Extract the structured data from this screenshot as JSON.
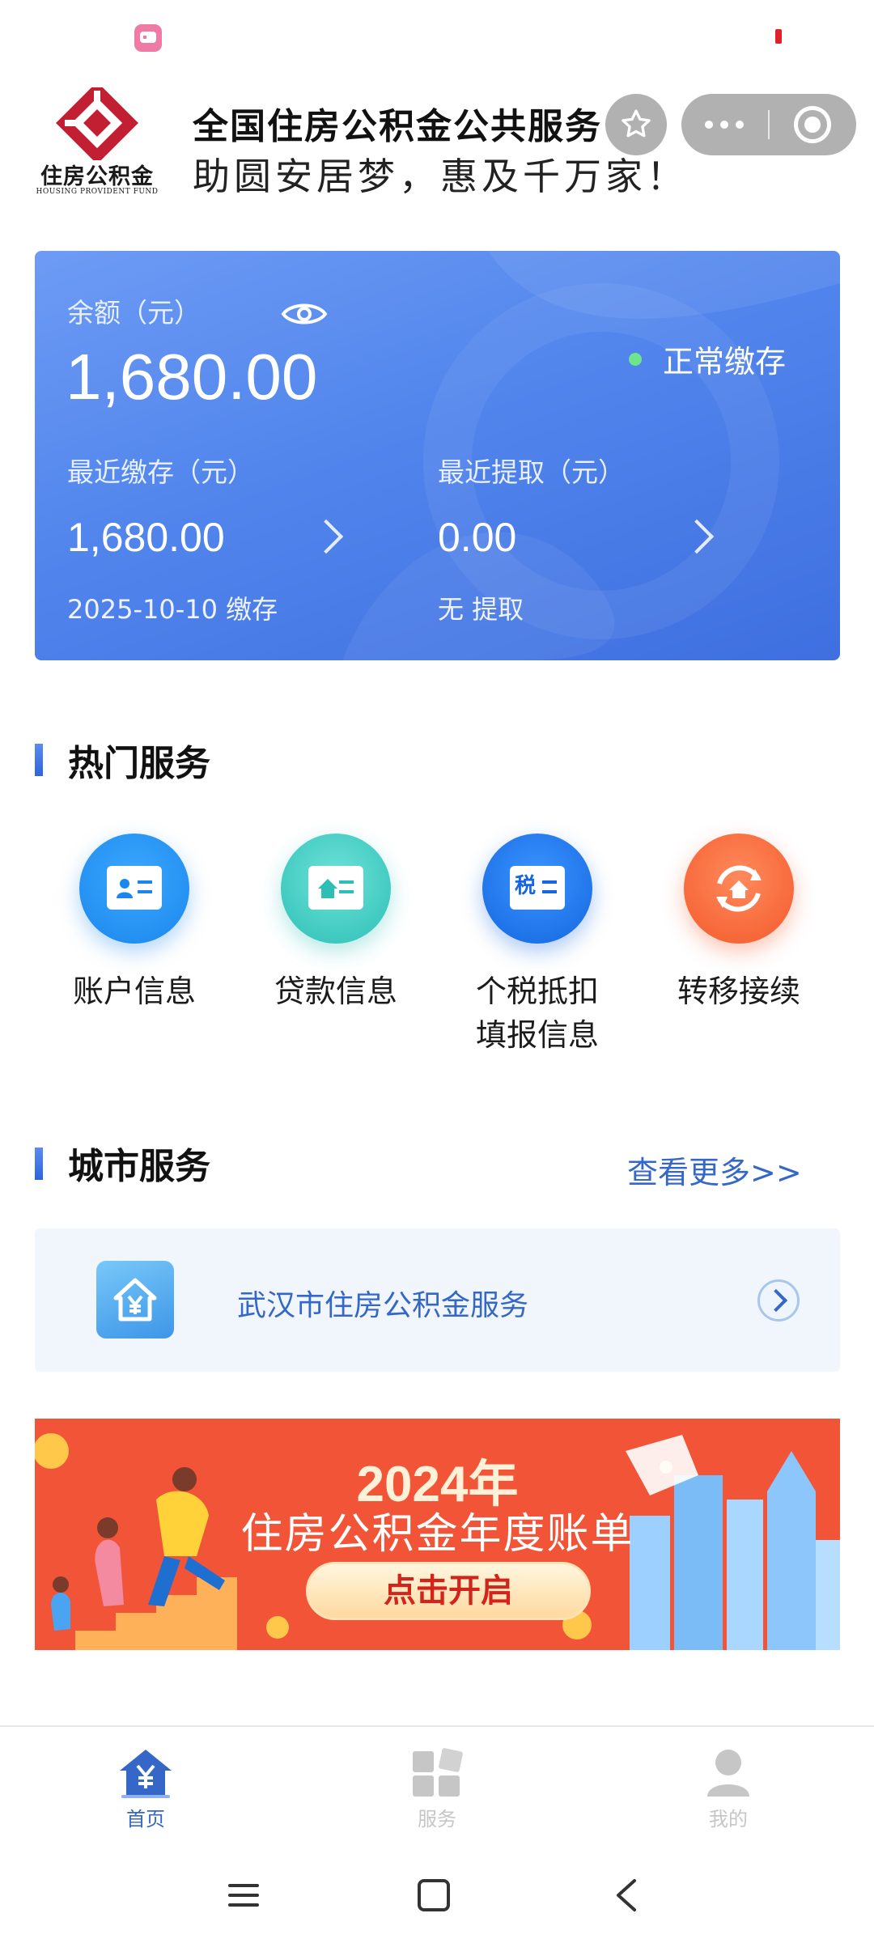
{
  "header": {
    "logo_text": "住房公积金",
    "logo_subtext": "HOUSING PROVIDENT FUND",
    "title": "全国住房公积金公共服务",
    "subtitle": "助圆安居梦，惠及千万家！"
  },
  "capsule": {
    "favorite_icon": "star-icon",
    "more_icon": "more-dots-icon",
    "close_icon": "target-close-icon"
  },
  "balance_card": {
    "balance_label": "余额（元）",
    "balance_value": "1,680.00",
    "status": "正常缴存",
    "status_color": "#6ee58a",
    "recent_deposit_label": "最近缴存（元）",
    "recent_deposit_value": "1,680.00",
    "recent_deposit_sub": "2025-10-10 缴存",
    "recent_withdraw_label": "最近提取（元）",
    "recent_withdraw_value": "0.00",
    "recent_withdraw_sub": "无 提取"
  },
  "hot_services": {
    "title": "热门服务",
    "items": [
      {
        "name": "账户信息",
        "icon": "account-card-icon",
        "color": "#2196f3"
      },
      {
        "name": "贷款信息",
        "icon": "loan-house-card-icon",
        "color": "#34c8c0"
      },
      {
        "name": "个税抵扣",
        "name_line2": "填报信息",
        "icon": "tax-card-icon",
        "badge": "税",
        "color": "#1e7be8"
      },
      {
        "name": "转移接续",
        "icon": "transfer-house-icon",
        "color": "#ff6a3d"
      }
    ]
  },
  "city_services": {
    "title": "城市服务",
    "more_link": "查看更多>>",
    "item": {
      "label": "武汉市住房公积金服务",
      "icon": "yuan-house-icon"
    }
  },
  "banner": {
    "year": "2024年",
    "title": "住房公积金年度账单",
    "button": "点击开启"
  },
  "tabbar": {
    "items": [
      {
        "label": "首页",
        "icon": "home-yuan-icon",
        "active": true
      },
      {
        "label": "服务",
        "icon": "services-grid-icon",
        "active": false
      },
      {
        "label": "我的",
        "icon": "profile-icon",
        "active": false
      }
    ],
    "active_color": "#3567c8",
    "inactive_color": "#c6c6c6"
  },
  "system_nav": {
    "items": [
      "menu-icon",
      "home-square-icon",
      "back-icon"
    ]
  }
}
